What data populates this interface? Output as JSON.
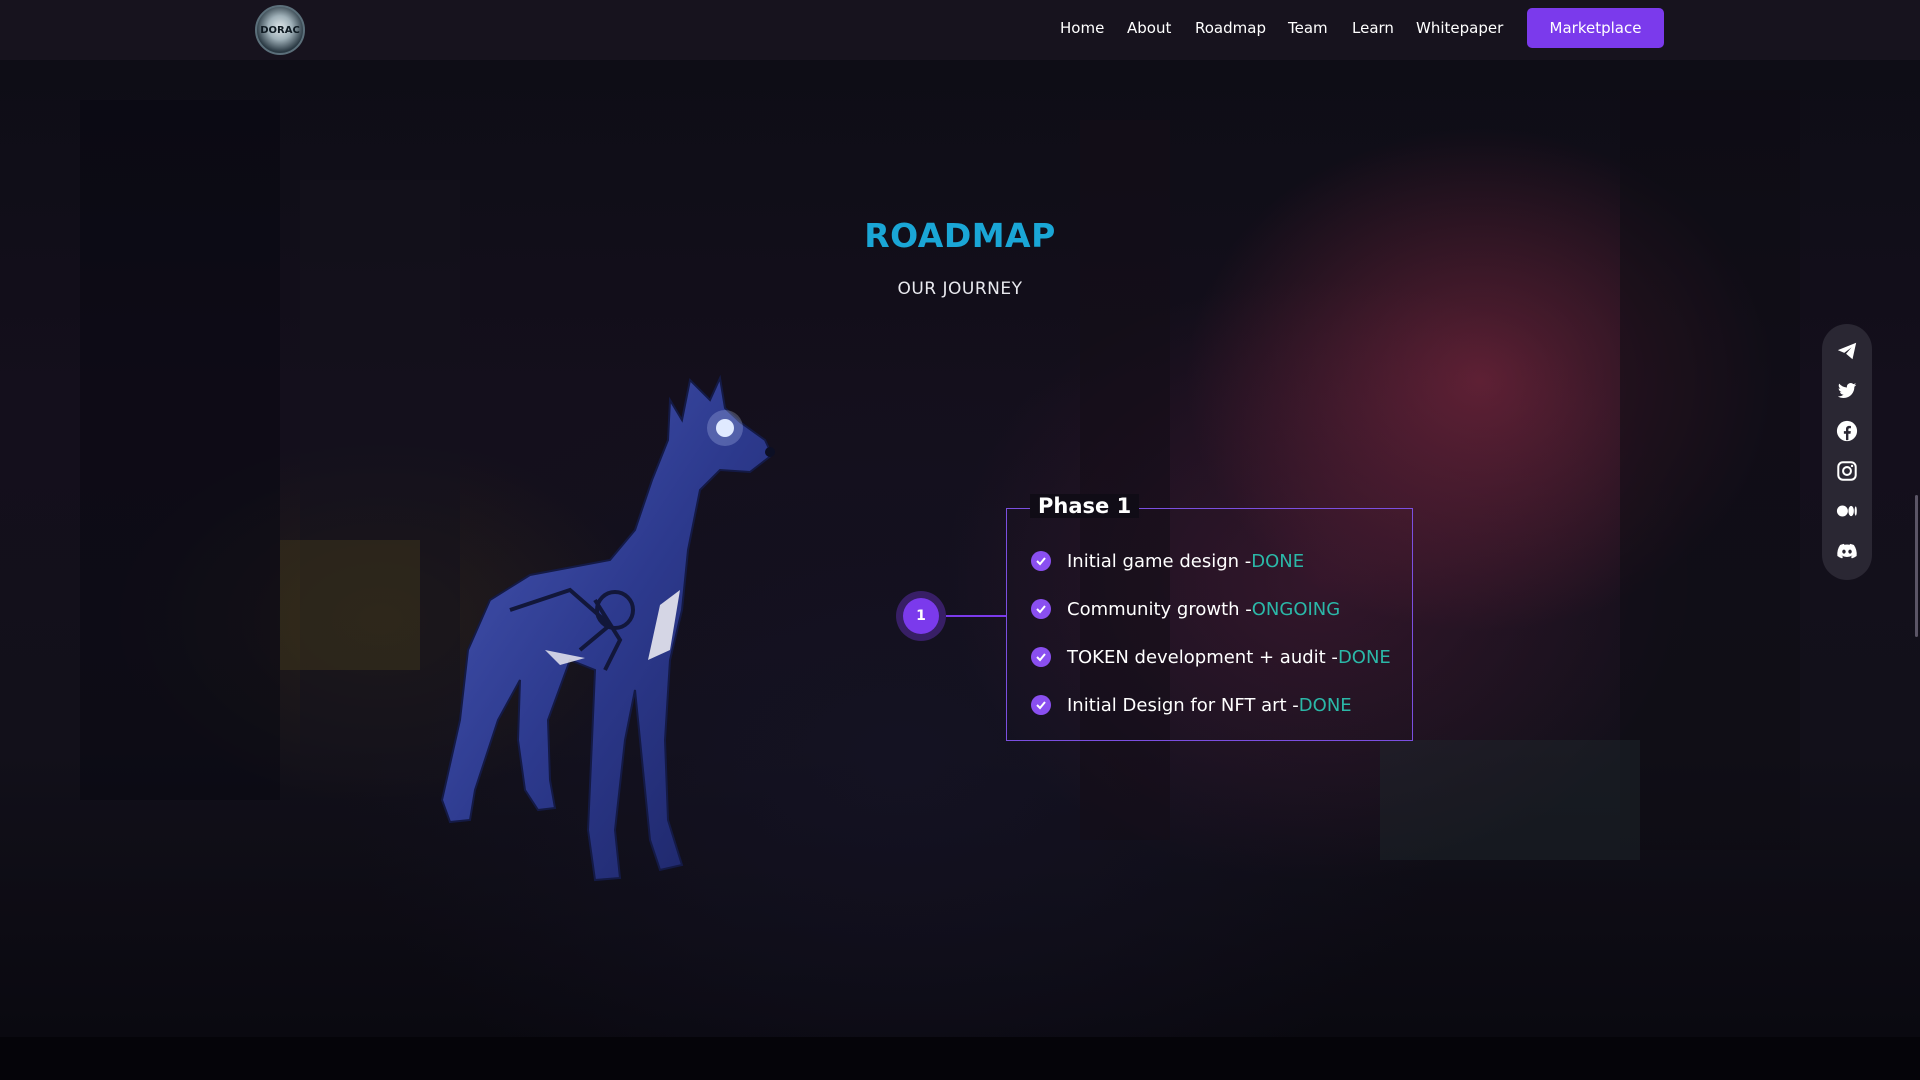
{
  "header": {
    "logo_text": "DORAC",
    "nav": [
      "Home",
      "About",
      "Roadmap",
      "Team",
      "Learn",
      "Whitepaper"
    ],
    "cta_label": "Marketplace"
  },
  "section": {
    "title": "ROADMAP",
    "subtitle": "OUR JOURNEY"
  },
  "timeline": {
    "node_number": "1",
    "phase_title": "Phase 1",
    "items": [
      {
        "text": "Initial game design - ",
        "status": "DONE"
      },
      {
        "text": "Community growth - ",
        "status": "ONGOING"
      },
      {
        "text": "TOKEN development + audit - ",
        "status": "DONE"
      },
      {
        "text": "Initial Design for NFT art - ",
        "status": "DONE"
      }
    ]
  },
  "social_icons": [
    "telegram-icon",
    "twitter-icon",
    "facebook-icon",
    "instagram-icon",
    "medium-icon",
    "discord-icon"
  ],
  "colors": {
    "accent": "#7b3aec",
    "title": "#1aa6d6",
    "status": "#2bb8a8",
    "dog": "#2e3a8c"
  }
}
